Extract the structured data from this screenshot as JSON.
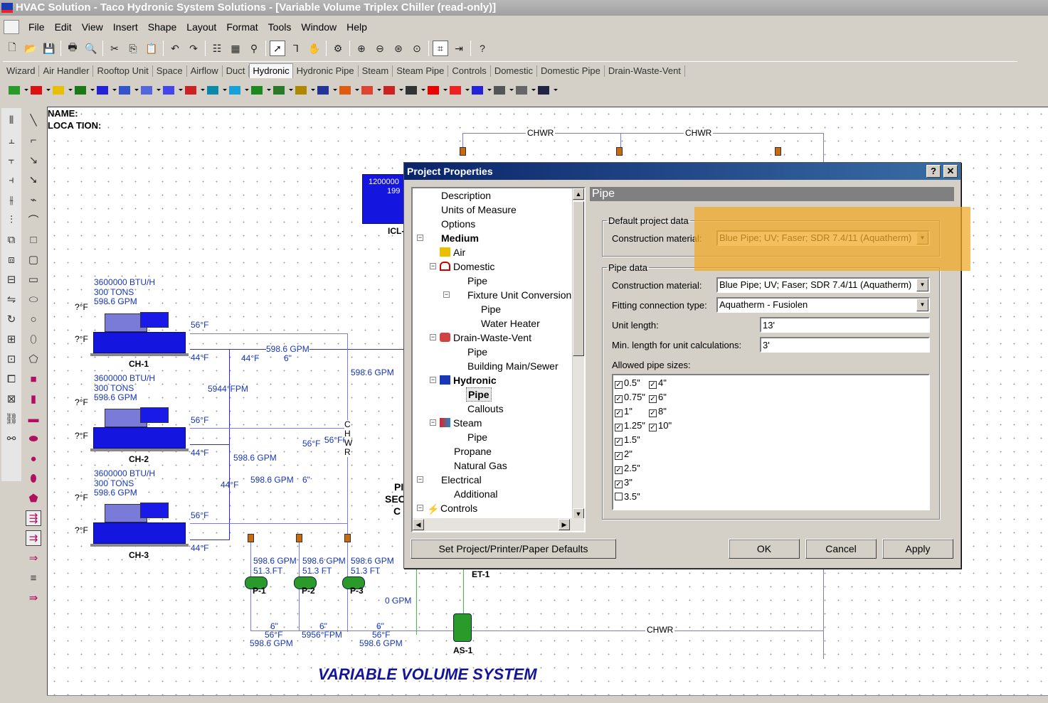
{
  "window": {
    "title": "HVAC Solution - Taco Hydronic System Solutions - [Variable Volume Triplex Chiller (read-only)]"
  },
  "menu": [
    "File",
    "Edit",
    "View",
    "Insert",
    "Shape",
    "Layout",
    "Format",
    "Tools",
    "Window",
    "Help"
  ],
  "tabs": [
    "Wizard",
    "Air Handler",
    "Rooftop Unit",
    "Space",
    "Airflow",
    "Duct",
    "Hydronic",
    "Hydronic Pipe",
    "Steam",
    "Steam Pipe",
    "Controls",
    "Domestic",
    "Domestic Pipe",
    "Drain-Waste-Vent"
  ],
  "active_tab": "Hydronic",
  "canvas": {
    "name_label": "NAME:",
    "location_label": "LOCA TION:",
    "chwr": "CHWR",
    "system_title": "VARIABLE VOLUME SYSTEM",
    "chillers": [
      {
        "name": "CH-1",
        "btu": "3600000 BTU/H",
        "tons": "300 TONS",
        "gpm": "598.6 GPM"
      },
      {
        "name": "CH-2",
        "btu": "3600000 BTU/H",
        "tons": "300 TONS",
        "gpm": "598.6 GPM"
      },
      {
        "name": "CH-3",
        "btu": "3600000 BTU/H",
        "tons": "300 TONS",
        "gpm": "598.6 GPM"
      }
    ],
    "pumps": [
      {
        "name": "P-1",
        "gpm": "598.6 GPM",
        "ft": "51.3 FT"
      },
      {
        "name": "P-2",
        "gpm": "598.6 GPM",
        "ft": "51.3 FT"
      },
      {
        "name": "P-3",
        "gpm": "598.6 GPM",
        "ft": "51.3 FT"
      }
    ],
    "labels": {
      "f56": "56°F",
      "f44": "44°F",
      "fq": "?°F",
      "gpm": "598.6 GPM",
      "six": "6\"",
      "fpm": "5944°FPM",
      "zero_gpm": "0 GPM",
      "et1": "ET-1",
      "as1": "AS-1",
      "icl": "ICL-",
      "icl_val1": "1200000",
      "icl_val2": "199",
      "chwr_vertical": "C H W R",
      "fpm2": "5956°FPM",
      "pi": "PI",
      "sec": "SEC",
      "c": "C",
      "f56_6": "56°F6\""
    }
  },
  "dialog": {
    "title": "Project Properties",
    "help_btn": "?",
    "close_btn": "✕",
    "tree": [
      "Description",
      "Units of Measure",
      "Options",
      "Medium",
      "Air",
      "Domestic",
      "Pipe",
      "Fixture Unit Conversion",
      "Pipe",
      "Water Heater",
      "Drain-Waste-Vent",
      "Pipe",
      "Building Main/Sewer",
      "Hydronic",
      "Pipe",
      "Callouts",
      "Steam",
      "Pipe",
      "Propane",
      "Natural Gas",
      "Electrical",
      "Additional",
      "Controls"
    ],
    "panel_title": "Pipe",
    "default_group": "Default project data",
    "pipe_group": "Pipe data",
    "construction_label": "Construction material:",
    "construction_value": "Blue Pipe; UV; Faser; SDR 7.4/11 (Aquatherm)",
    "fitting_label": "Fitting connection type:",
    "fitting_value": "Aquatherm - Fusiolen",
    "unit_length_label": "Unit length:",
    "unit_length_value": "13'",
    "min_length_label": "Min. length for unit calculations:",
    "min_length_value": "3'",
    "allowed_label": "Allowed pipe sizes:",
    "sizes": [
      {
        "label": "0.5\"",
        "checked": true
      },
      {
        "label": "0.75\"",
        "checked": true
      },
      {
        "label": "1\"",
        "checked": true
      },
      {
        "label": "1.25\"",
        "checked": true
      },
      {
        "label": "1.5\"",
        "checked": true
      },
      {
        "label": "2\"",
        "checked": true
      },
      {
        "label": "2.5\"",
        "checked": true
      },
      {
        "label": "3\"",
        "checked": true
      },
      {
        "label": "3.5\"",
        "checked": false
      },
      {
        "label": "4\"",
        "checked": true
      },
      {
        "label": "6\"",
        "checked": true
      },
      {
        "label": "8\"",
        "checked": true
      },
      {
        "label": "10\"",
        "checked": true
      }
    ],
    "btn_defaults": "Set Project/Printer/Paper Defaults",
    "btn_ok": "OK",
    "btn_cancel": "Cancel",
    "btn_apply": "Apply"
  },
  "colors": {
    "highlight": "#f0aa28",
    "dialog_title": "#0a246a",
    "pipe_blue": "#7b7bdc",
    "chiller_blue": "#1515e0"
  }
}
